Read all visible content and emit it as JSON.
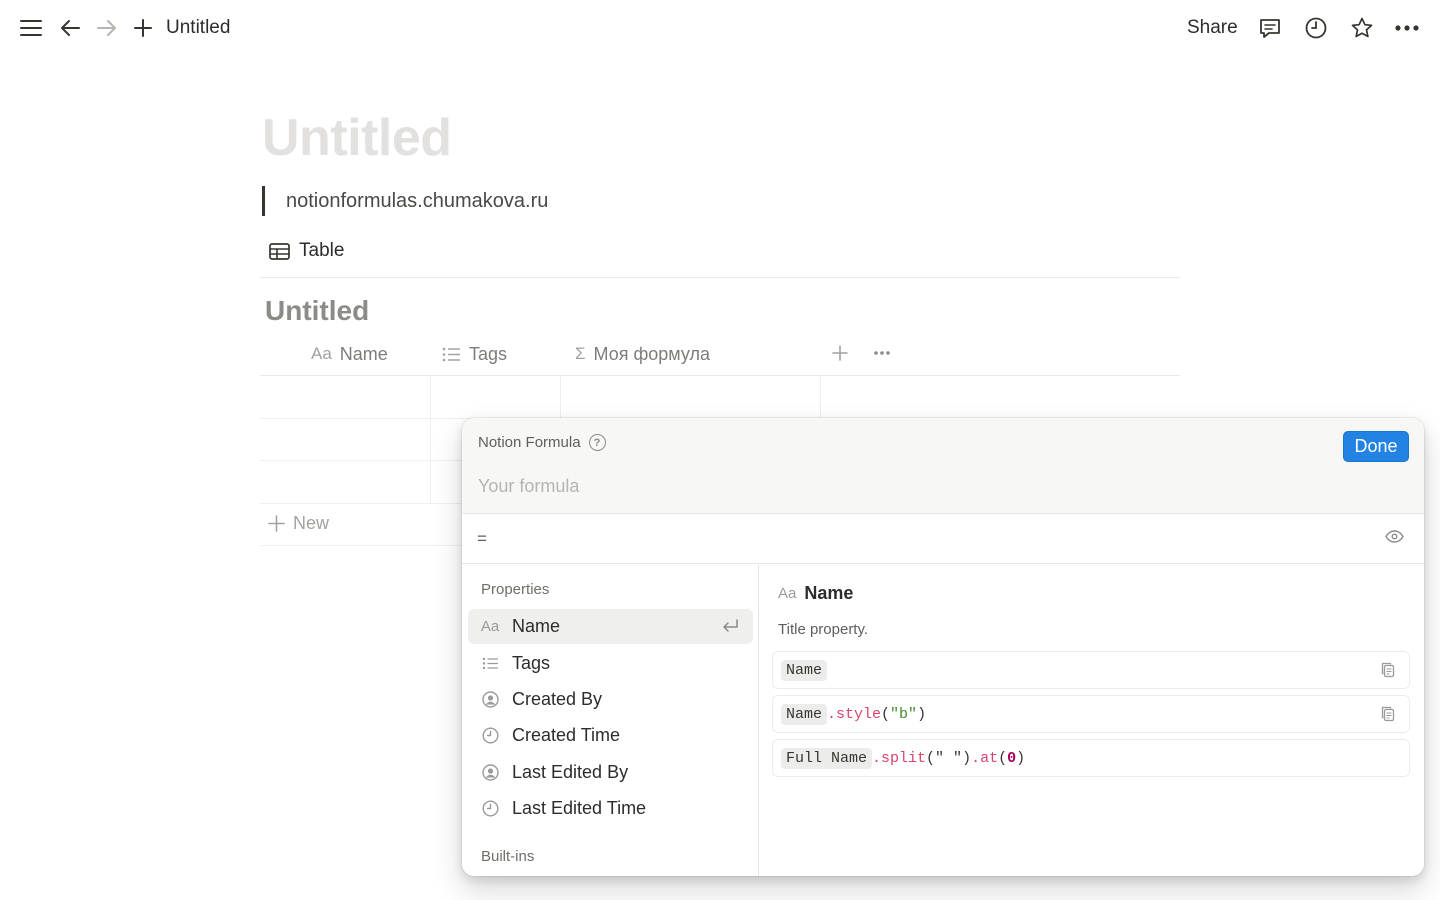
{
  "topbar": {
    "icons": [
      "menu-icon",
      "back-arrow-icon",
      "forward-arrow-icon",
      "plus-icon",
      "comment-icon",
      "history-clock-icon",
      "star-icon",
      "more-horizontal-icon"
    ],
    "breadcrumb_title": "Untitled",
    "share_label": "Share"
  },
  "page": {
    "title": "Untitled",
    "quote": "notionformulas.chumakova.ru"
  },
  "database": {
    "view_tab_label": "Table",
    "title": "Untitled",
    "columns": [
      {
        "icon": "Aa",
        "label": "Name"
      },
      {
        "icon": "list-icon",
        "label": "Tags"
      },
      {
        "icon": "Σ",
        "label": "Моя формула"
      }
    ],
    "more_glyph": "•••",
    "new_row_label": "New",
    "row_count": 3
  },
  "formula_modal": {
    "label": "Notion Formula",
    "help_glyph": "?",
    "done_label": "Done",
    "placeholder": "Your formula",
    "result_prefix": "=",
    "properties_label": "Properties",
    "builtins_label": "Built-ins",
    "properties": [
      {
        "icon": "Aa",
        "label": "Name",
        "selected": true
      },
      {
        "icon": "list-icon",
        "label": "Tags",
        "selected": false
      },
      {
        "icon": "person-circle-icon",
        "label": "Created By",
        "selected": false
      },
      {
        "icon": "clock-icon",
        "label": "Created Time",
        "selected": false
      },
      {
        "icon": "person-circle-icon",
        "label": "Last Edited By",
        "selected": false
      },
      {
        "icon": "clock-icon",
        "label": "Last Edited Time",
        "selected": false
      }
    ],
    "detail": {
      "icon": "Aa",
      "name": "Name",
      "description": "Title property.",
      "examples": [
        {
          "prop": "Name",
          "method": "",
          "open": "",
          "arg": "",
          "close": "",
          "method2": "",
          "arg2": "",
          "close2": ""
        },
        {
          "prop": "Name",
          "method": ".style",
          "open": "(",
          "arg": "\"b\"",
          "close": ")",
          "method2": "",
          "arg2": "",
          "close2": ""
        },
        {
          "prop": "Full Name",
          "method": ".split",
          "open": "(",
          "arg": "\" \"",
          "close": ")",
          "method2": ".at",
          "arg2": "0",
          "close2": ")"
        }
      ]
    }
  },
  "colors": {
    "accent": "#2383e2",
    "title_placeholder": "#e2e1df",
    "method_pink": "#d9456a",
    "string_green": "#448b2f"
  }
}
